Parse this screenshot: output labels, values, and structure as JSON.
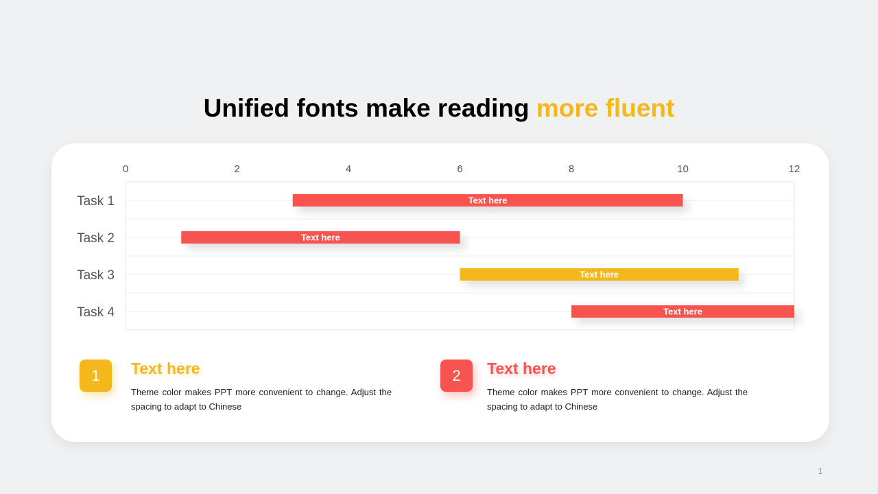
{
  "slide": {
    "title_main": "Unified fonts make reading ",
    "title_accent": "more fluent",
    "page_number": "1"
  },
  "colors": {
    "red": "#f7534f",
    "yellow": "#f5b81c"
  },
  "chart_data": {
    "type": "bar",
    "orientation": "horizontal-gantt",
    "xlim": [
      0,
      12
    ],
    "xticks": [
      0,
      2,
      4,
      6,
      8,
      10,
      12
    ],
    "x_axis_position": "top",
    "grid": true,
    "tasks": [
      {
        "name": "Task 1",
        "start": 3,
        "end": 10,
        "label": "Text here",
        "color": "#f7534f"
      },
      {
        "name": "Task 2",
        "start": 1,
        "end": 6,
        "label": "Text here",
        "color": "#f7534f"
      },
      {
        "name": "Task 3",
        "start": 6,
        "end": 11,
        "label": "Text here",
        "color": "#f5b81c"
      },
      {
        "name": "Task 4",
        "start": 8,
        "end": 12,
        "label": "Text here",
        "color": "#f7534f"
      }
    ]
  },
  "info": [
    {
      "number": "1",
      "heading": "Text here",
      "body": "Theme  color makes PPT more convenient  to change. Adjust the spacing to adapt to Chinese"
    },
    {
      "number": "2",
      "heading": "Text here",
      "body": "Theme  color makes PPT more convenient  to change. Adjust the spacing to adapt to Chinese"
    }
  ]
}
